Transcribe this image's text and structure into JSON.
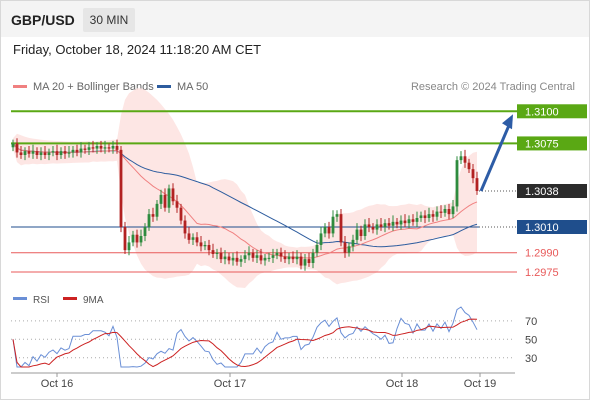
{
  "header": {
    "symbol": "GBP/USD",
    "timeframe": "30 MIN",
    "timestamp": "Friday, October 18, 2024 11:18:20 AM CET"
  },
  "legend": {
    "ma20_label": "MA 20 + Bollinger Bands",
    "ma50_label": "MA 50"
  },
  "credit": "Research © 2024 Trading Central",
  "colors": {
    "resistance": "#5aa814",
    "support": "#e85a5a",
    "pivot": "#1f4e8c",
    "current": "#2b2b2b",
    "ma20": "#f08080",
    "ma50": "#2d5c9e",
    "band": "#fde3e1",
    "bull": "#2e8b3e",
    "bear": "#b22222",
    "rsi": "#6a8fd6",
    "rsi_ma": "#cc2222",
    "arrow": "#2d5ca6"
  },
  "chart_data": [
    {
      "type": "candlestick",
      "title": "GBP/USD 30 MIN",
      "price_range": [
        1.2968,
        1.3108
      ],
      "x_ticks": [
        "Oct 16",
        "Oct 17",
        "Oct 18",
        "Oct 19"
      ],
      "levels": [
        {
          "name": "resistance-2",
          "value": 1.31,
          "label": "1.3100",
          "kind": "resistance"
        },
        {
          "name": "resistance-1",
          "value": 1.3075,
          "label": "1.3075",
          "kind": "resistance"
        },
        {
          "name": "current",
          "value": 1.3038,
          "label": "1.3038",
          "kind": "current"
        },
        {
          "name": "pivot",
          "value": 1.301,
          "label": "1.3010",
          "kind": "pivot"
        },
        {
          "name": "support-1",
          "value": 1.299,
          "label": "1.2990",
          "kind": "support"
        },
        {
          "name": "support-2",
          "value": 1.2975,
          "label": "1.2975",
          "kind": "support"
        }
      ],
      "forecast_arrow": {
        "from": 1.3038,
        "to": 1.31
      },
      "close": [
        1.3075,
        1.3068,
        1.3066,
        1.3069,
        1.3067,
        1.3069,
        1.3066,
        1.3068,
        1.3066,
        1.3068,
        1.3069,
        1.3066,
        1.3069,
        1.3067,
        1.3068,
        1.307,
        1.3068,
        1.3071,
        1.307,
        1.3072,
        1.3071,
        1.3073,
        1.3071,
        1.3072,
        1.3071,
        1.3073,
        1.307,
        1.301,
        1.2992,
        1.2998,
        1.3004,
        1.2998,
        1.3003,
        1.301,
        1.302,
        1.3018,
        1.3028,
        1.3035,
        1.3025,
        1.304,
        1.303,
        1.3025,
        1.3015,
        1.3005,
        1.3,
        1.3002,
        1.2998,
        1.2995,
        1.2996,
        1.2992,
        1.2989,
        1.299,
        1.2985,
        1.2987,
        1.2984,
        1.2986,
        1.2983,
        1.2985,
        1.2988,
        1.299,
        1.2986,
        1.2988,
        1.2984,
        1.2986,
        1.2986,
        1.2988,
        1.299,
        1.2987,
        1.2985,
        1.2987,
        1.2985,
        1.2987,
        1.298,
        1.2985,
        1.2982,
        1.299,
        1.2996,
        1.3005,
        1.301,
        1.3005,
        1.3018,
        1.302,
        1.2998,
        1.299,
        1.2995,
        1.3,
        1.3008,
        1.3003,
        1.3012,
        1.301,
        1.3008,
        1.3012,
        1.301,
        1.3013,
        1.3011,
        1.3014,
        1.3012,
        1.3015,
        1.3013,
        1.3016,
        1.3014,
        1.3017,
        1.3019,
        1.3017,
        1.302,
        1.3018,
        1.3022,
        1.3021,
        1.3024,
        1.302,
        1.3026,
        1.3062,
        1.3065,
        1.306,
        1.3055,
        1.3048,
        1.3038
      ],
      "rsi_axis": [
        30,
        50,
        70
      ],
      "rsi_range": [
        20,
        85
      ]
    }
  ]
}
